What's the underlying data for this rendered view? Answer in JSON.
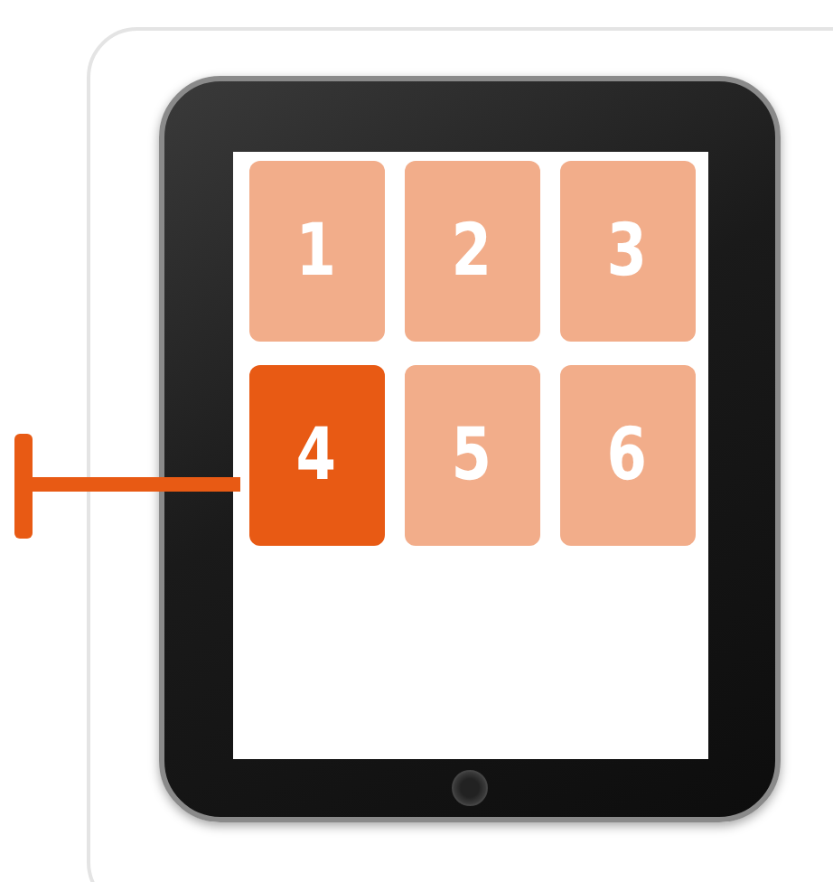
{
  "tiles": [
    {
      "label": "1",
      "selected": false
    },
    {
      "label": "2",
      "selected": false
    },
    {
      "label": "3",
      "selected": false
    },
    {
      "label": "4",
      "selected": true
    },
    {
      "label": "5",
      "selected": false
    },
    {
      "label": "6",
      "selected": false
    }
  ]
}
